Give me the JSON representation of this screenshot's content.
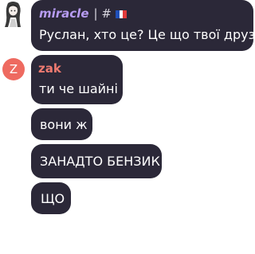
{
  "messages": [
    {
      "author": "miracle",
      "author_suffix": "| #",
      "flag": "france-flag-icon",
      "text": "Руслан, хто це? Це що твої друзі?"
    },
    {
      "author": "zak",
      "avatar_letter": "Z",
      "text": "ти че шайні"
    },
    {
      "text": "вони ж"
    },
    {
      "text": "ЗАНАДТО БЕНЗИК"
    },
    {
      "text": "ЩО"
    }
  ],
  "colors": {
    "bubble": "#2b2838",
    "miracle_name": "#b79cf2",
    "zak_name": "#ef7a70",
    "zak_avatar": "#ee6a60"
  }
}
